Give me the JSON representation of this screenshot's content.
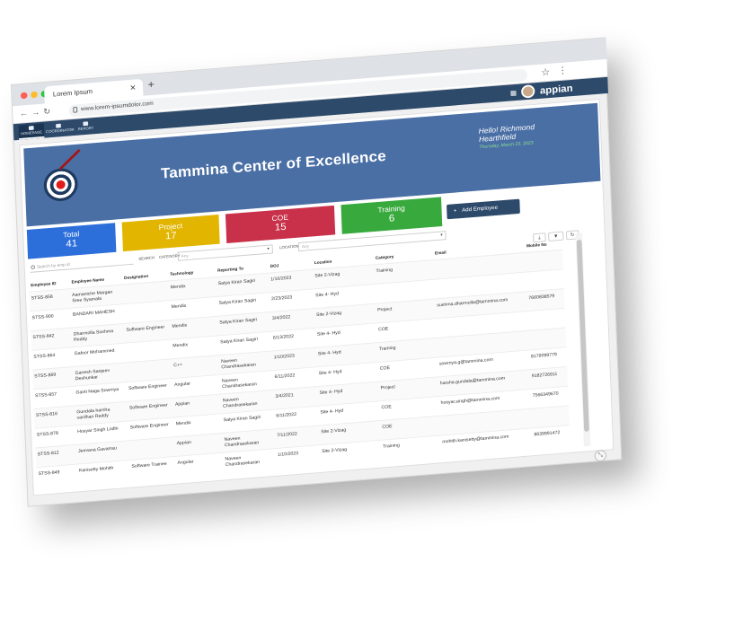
{
  "browser": {
    "tab_title": "Lorem Ipsum",
    "url": "www.lorem-ipsumdolor.com"
  },
  "nav": {
    "items": [
      "HOMEPAGE",
      "COORDINATOR",
      "REPORT"
    ],
    "brand": "appian"
  },
  "hero": {
    "title": "Tammina Center of Excellence",
    "greeting": "Hello! Richmond Hearthfield",
    "date": "Thursday, March 23, 2023"
  },
  "stats": [
    {
      "label": "Total",
      "value": "41",
      "color": "#2c6fdb"
    },
    {
      "label": "Project",
      "value": "17",
      "color": "#e2b500"
    },
    {
      "label": "COE",
      "value": "15",
      "color": "#c93049"
    },
    {
      "label": "Training",
      "value": "6",
      "color": "#38a93c"
    }
  ],
  "add_button": "Add Employee",
  "filters": {
    "search_placeholder": "Search by emp id",
    "search_label": "SEARCH",
    "category_label": "CATEGORY",
    "category_value": "Any",
    "location_label": "LOCATION",
    "location_value": "Any"
  },
  "table": {
    "headers": [
      "Employee ID",
      "Employee Name",
      "Designation",
      "Technology",
      "Reporting To",
      "DOJ",
      "Location",
      "Category",
      "Email",
      "Mobile No"
    ],
    "rows": [
      [
        "STSS-858",
        "Aamaniche Margan Sree Syamala",
        "",
        "Mendix",
        "Satya Kiran Sagiri",
        "1/10/2023",
        "Site 2-Vizag",
        "Training",
        "",
        ""
      ],
      [
        "STSS-900",
        "BANDARI MAHESH",
        "",
        "Mendix",
        "Satya Kiran Sagiri",
        "2/23/2023",
        "Site 4- Hyd",
        "",
        "",
        ""
      ],
      [
        "STSS-842",
        "Dharmolla Sushma Reddy",
        "Software Engineer",
        "Mendix",
        "Satya Kiran Sagiri",
        "3/4/2022",
        "Site 2-Vizag",
        "Project",
        "sushma.dharmolla@tammina.com",
        "7660838579"
      ],
      [
        "STSS-864",
        "Gafoor Mohammed",
        "",
        "Mendix",
        "Satya Kiran Sagiri",
        "6/13/2022",
        "Site 4- Hyd",
        "COE",
        "",
        ""
      ],
      [
        "STSS-869",
        "Ganesh Sanjeev Deshunkar",
        "",
        "C++",
        "Naveen Chandrasekaran",
        "1/10/2023",
        "Site 4- Hyd",
        "Training",
        "",
        ""
      ],
      [
        "STSS-857",
        "Ganti Naga Sowmya",
        "Software Engineer",
        "Angular",
        "Naveen Chandrasekaran",
        "6/11/2022",
        "Site 4- Hyd",
        "COE",
        "sowmya.g@tammina.com",
        "8179099779"
      ],
      [
        "STSS-816",
        "Gundala harsha vardhan Reddy",
        "Software Engineer",
        "Appian",
        "Naveen Chandrasekaran",
        "3/4/2021",
        "Site 4- Hyd",
        "Project",
        "harsha.gundala@tammina.com",
        "9182726911"
      ],
      [
        "STSS-878",
        "Hosyar Singh Lodhi",
        "Software Engineer",
        "Mendix",
        "Satya Kiran Sagiri",
        "6/11/2022",
        "Site 4- Hyd",
        "COE",
        "hosyar.singh@tammina.com",
        "7566349670"
      ],
      [
        "STSS-812",
        "Jeevana Gavarrau",
        "",
        "Appian",
        "Naveen Chandrasekaran",
        "7/11/2022",
        "Site 2-Vizag",
        "COE",
        "",
        ""
      ],
      [
        "STSS-849",
        "Kanisetty Mohith",
        "Software Trainee",
        "Angular",
        "Naveen Chandrasekaran",
        "1/10/2023",
        "Site 2-Vizag",
        "Training",
        "mohith.kanisetty@tammina.com",
        "8639991472"
      ]
    ]
  },
  "icons": {
    "download": "download-icon",
    "filter": "filter-icon",
    "refresh": "refresh-icon"
  }
}
